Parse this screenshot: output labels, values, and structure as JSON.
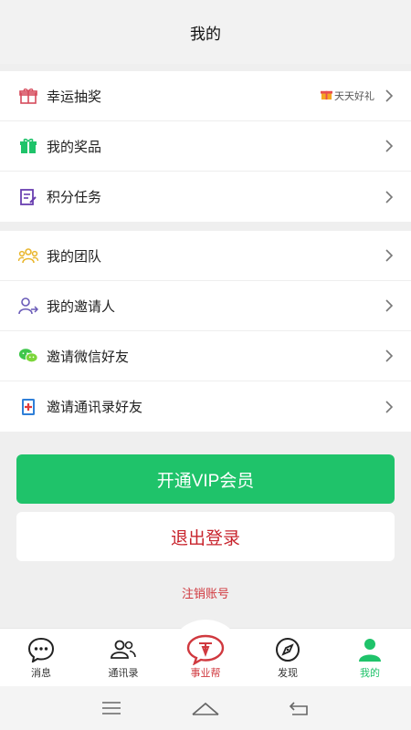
{
  "header": {
    "title": "我的"
  },
  "group1": [
    {
      "label": "幸运抽奖",
      "icon": "gift-box-icon",
      "extra": "天天好礼"
    },
    {
      "label": "我的奖品",
      "icon": "prize-gift-icon"
    },
    {
      "label": "积分任务",
      "icon": "task-edit-icon"
    }
  ],
  "group2": [
    {
      "label": "我的团队",
      "icon": "team-icon"
    },
    {
      "label": "我的邀请人",
      "icon": "inviter-icon"
    },
    {
      "label": "邀请微信好友",
      "icon": "wechat-icon"
    },
    {
      "label": "邀请通讯录好友",
      "icon": "contacts-book-icon"
    }
  ],
  "actions": {
    "vip": "开通VIP会员",
    "logout": "退出登录",
    "cancel_account": "注销账号"
  },
  "tabbar": [
    {
      "label": "消息",
      "icon": "message-icon"
    },
    {
      "label": "通讯录",
      "icon": "contacts-icon"
    },
    {
      "label": "事业帮",
      "icon": "career-icon"
    },
    {
      "label": "发现",
      "icon": "compass-icon"
    },
    {
      "label": "我的",
      "icon": "profile-icon",
      "active": true
    }
  ],
  "colors": {
    "accent": "#1fc36a",
    "danger": "#c8242d",
    "background": "#efefef"
  }
}
